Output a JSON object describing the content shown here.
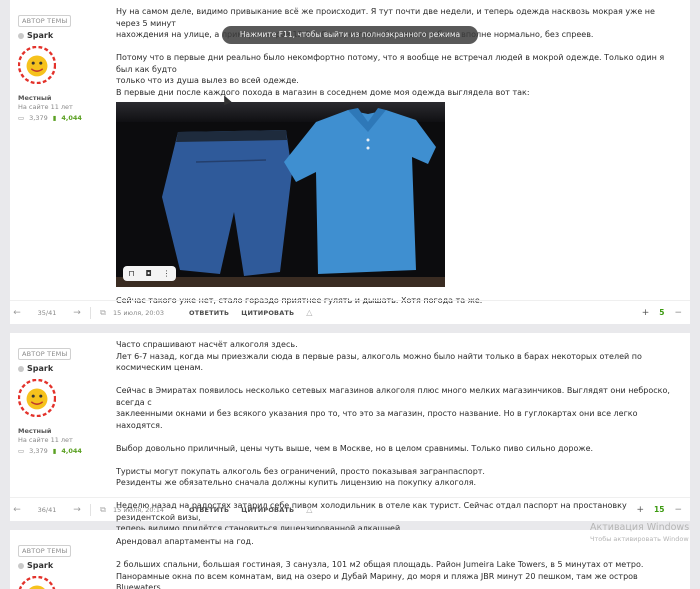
{
  "toast": {
    "text": "Нажмите F11, чтобы выйти из полноэкранного режима"
  },
  "posts": [
    {
      "author": {
        "badge": "АВТОР ТЕМЫ",
        "name": "Spark",
        "rank": "Местный",
        "since": "На сайте 11 лет",
        "posts": "3,379",
        "reputation": "4,044"
      },
      "content": {
        "p1": "Ну на самом деле, видимо привыкание всё же происходит. Я тут почти две недели, и теперь одежда насквозь мокрая уже не через 5 минут",
        "p2": "нахождения на улице, а примерно через 15-20. Сегодня гулял без маски и было вполне нормально, без спреев.",
        "p3": "Потому что в первые дни реально было некомфортно потому, что я вообще не встречал людей в мокрой одежде. Только один я был как будто",
        "p4": "только что из душа вылез во всей одежде.",
        "p5": "В первые дни после каждого похода в магазин в соседнем доме моя одежда выглядела вот так:",
        "after_image": "Сейчас такого уже нет, стало гораздо приятнее гулять и дышать. Хотя погода та же."
      },
      "footer": {
        "count": "35/41",
        "date": "15 июля, 20:03",
        "reply": "ОТВЕТИТЬ",
        "quote": "ЦИТИРОВАТЬ",
        "score": "5"
      }
    },
    {
      "author": {
        "badge": "АВТОР ТЕМЫ",
        "name": "Spark",
        "rank": "Местный",
        "since": "На сайте 11 лет",
        "posts": "3,379",
        "reputation": "4,044"
      },
      "content": {
        "p1": "Часто спрашивают насчёт алкоголя здесь.",
        "p2": "Лет 6-7 назад, когда мы приезжали сюда в первые разы, алкоголь можно было найти только в барах некоторых отелей по космическим ценам.",
        "p3": "Сейчас в Эмиратах появилось несколько сетевых магазинов алкоголя плюс много мелких магазинчиков. Выглядят они неброско, всегда с",
        "p4": "заклеенными окнами и без всякого указания про то, что это за магазин, просто название. Но в гуглокартах они все легко находятся.",
        "p5": "Выбор довольно приличный, цены чуть выше, чем в Москве, но в целом сравнимы. Только пиво сильно дороже.",
        "p6": "Туристы могут покупать алкоголь без ограничений, просто показывая загранпаспорт.",
        "p7": "Резиденты же обязательно сначала должны купить лицензию на покупку алкоголя.",
        "p8": "Неделю назад на радостях затарил себе пивом холодильник в отеле как турист. Сейчас отдал паспорт на простановку резидентской визы,",
        "p9": "теперь видимо придётся становиться лицензированной алкашней."
      },
      "footer": {
        "count": "36/41",
        "date": "15 июля, 20:14",
        "reply": "ОТВЕТИТЬ",
        "quote": "ЦИТИРОВАТЬ",
        "score": "15"
      }
    },
    {
      "author": {
        "badge": "АВТОР ТЕМЫ",
        "name": "Spark"
      },
      "content": {
        "p1": "Арендовал апартаменты на год.",
        "p2": "2 больших спальни, большая гостиная, 3 санузла, 101 м2 общая площадь. Район Jumeira Lake Towers, в 5 минутах от метро.",
        "p3": "Панорамные окна по всем комнатам, вид на озеро и Дубай Марину, до моря и пляжа JBR минут 20 пешком, там же остров Bluewaters."
      }
    }
  ],
  "watermark": {
    "title": "Активация Windows",
    "subtitle": "Чтобы активировать Window"
  },
  "colors": {
    "reputation": "#5aa021",
    "score": "#3c9a10",
    "background": "#e9e9ec"
  }
}
